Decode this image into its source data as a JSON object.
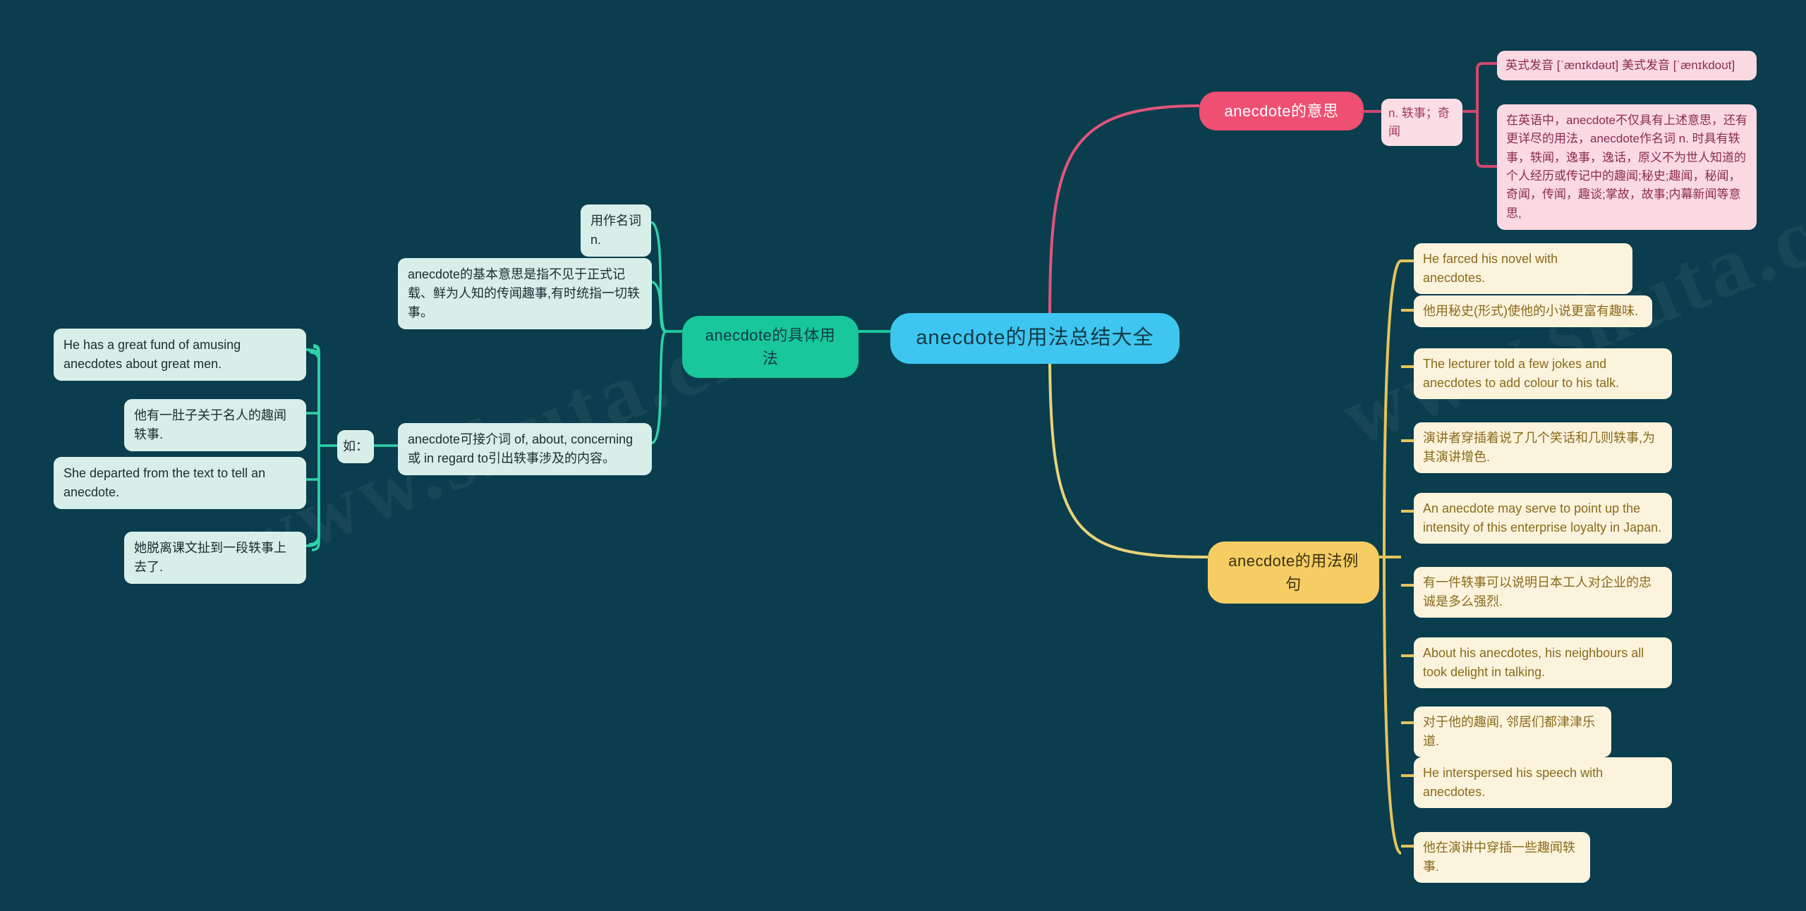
{
  "background_color": "#0a3d4d",
  "root": {
    "label": "anecdote的用法总结大全",
    "color": "#3ec6f0"
  },
  "watermarks": [
    "www.shuta.cn",
    "www.shuta.cn"
  ],
  "branches": [
    {
      "id": "specific-usage",
      "label": "anecdote的具体用法",
      "color": "#18c79a",
      "side": "left",
      "children": [
        {
          "id": "used-as-noun",
          "label": "用作名词 n."
        },
        {
          "id": "basic-meaning",
          "label": "anecdote的基本意思是指不见于正式记载、鲜为人知的传闻趣事,有时统指一切轶事。"
        },
        {
          "id": "prepositions",
          "label": "anecdote可接介词 of, about, concerning 或 in regard to引出轶事涉及的内容。"
        },
        {
          "id": "ru-label",
          "label": "如："
        }
      ],
      "examples": [
        {
          "id": "ex-en-1",
          "label": "He has a great fund of amusing anecdotes about great men."
        },
        {
          "id": "ex-zh-1",
          "label": "他有一肚子关于名人的趣闻轶事."
        },
        {
          "id": "ex-en-2",
          "label": "She departed from the text to tell an anecdote."
        },
        {
          "id": "ex-zh-2",
          "label": "她脱离课文扯到一段轶事上去了."
        }
      ]
    },
    {
      "id": "meaning",
      "label": "anecdote的意思",
      "color": "#ef4f72",
      "side": "right-top",
      "children": [
        {
          "id": "pos-gloss",
          "label": "n. 轶事；奇闻"
        }
      ],
      "grandchildren": [
        {
          "id": "pronunciation",
          "label": "英式发音 [ˈænɪkdəʊt] 美式发音 [ˈænɪkdoʊt]"
        },
        {
          "id": "detailed-usage",
          "label": "在英语中，anecdote不仅具有上述意思，还有更详尽的用法，anecdote作名词 n. 时具有轶事，轶闻，逸事，逸话，原义不为世人知道的个人经历或传记中的趣闻;秘史;趣闻，秘闻，奇闻，传闻，趣谈;掌故，故事;内幕新闻等意思,"
        }
      ]
    },
    {
      "id": "example-sentences",
      "label": "anecdote的用法例句",
      "color": "#f6cd63",
      "side": "right-bottom",
      "children": [
        {
          "id": "y-1",
          "label": "He farced his novel with anecdotes."
        },
        {
          "id": "y-2",
          "label": "他用秘史(形式)使他的小说更富有趣味."
        },
        {
          "id": "y-3",
          "label": "The lecturer told a few jokes and anecdotes to add colour to his talk."
        },
        {
          "id": "y-4",
          "label": "演讲者穿插着说了几个笑话和几则轶事,为其演讲增色."
        },
        {
          "id": "y-5",
          "label": "An anecdote may serve to point up the intensity of this enterprise loyalty in Japan."
        },
        {
          "id": "y-6",
          "label": "有一件轶事可以说明日本工人对企业的忠诚是多么强烈."
        },
        {
          "id": "y-7",
          "label": "About his anecdotes, his neighbours all took delight in talking."
        },
        {
          "id": "y-8",
          "label": "对于他的趣闻, 邻居们都津津乐道."
        },
        {
          "id": "y-9",
          "label": "He interspersed his speech with anecdotes."
        },
        {
          "id": "y-10",
          "label": "他在演讲中穿插一些趣闻轶事."
        }
      ]
    }
  ]
}
